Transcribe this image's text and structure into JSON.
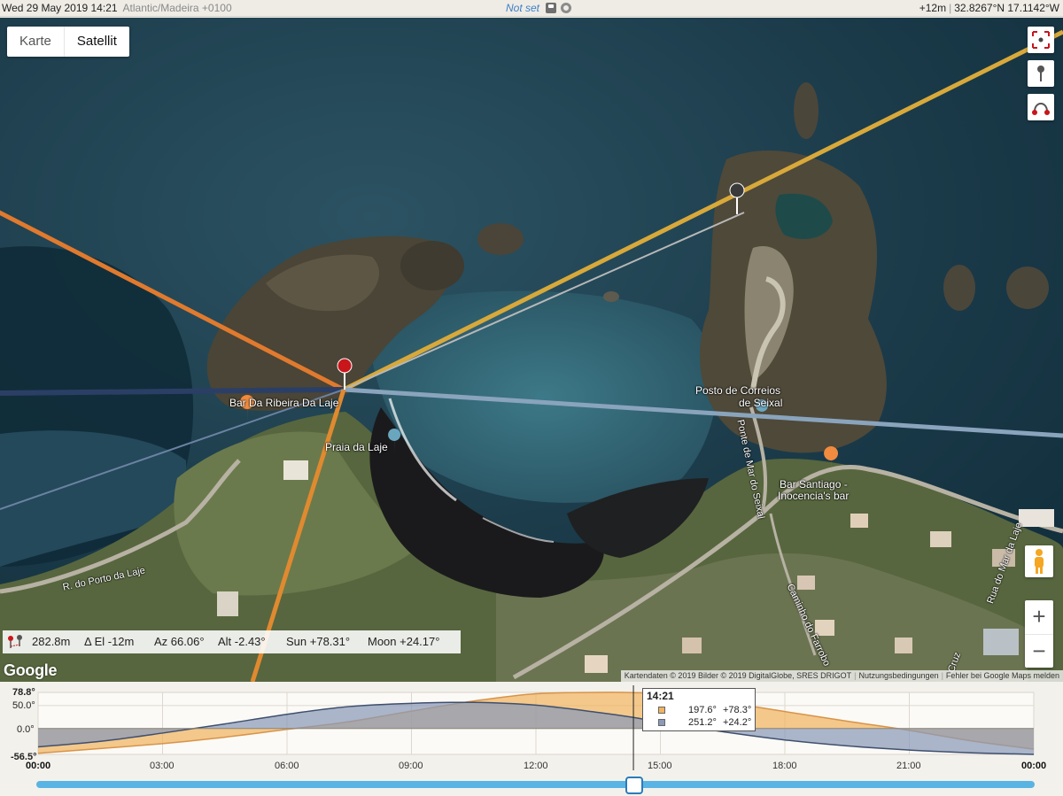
{
  "topbar": {
    "datetime": "Wed 29 May 2019 14:21",
    "timezone": "Atlantic/Madeira +0100",
    "status": "Not set",
    "elevation": "+12m",
    "coords": "32.8267°N 17.1142°W"
  },
  "map": {
    "type_buttons": [
      "Karte",
      "Satellit"
    ],
    "active_type": "Satellit",
    "zoom_in": "+",
    "zoom_out": "−",
    "google_logo": "Google",
    "attribution": {
      "data": "Kartendaten © 2019 Bilder © 2019 DigitalGlobe, SRES DRIGOT",
      "terms": "Nutzungsbedingungen",
      "report": "Fehler bei Google Maps melden"
    },
    "labels": {
      "bar_ribeira": "Bar Da Ribeira Da Laje",
      "praia": "Praia da Laje",
      "posto_1": "Posto de Correios",
      "posto_2": "de Seixal",
      "bar_santiago_1": "Bar Santiago -",
      "bar_santiago_2": "Inocencia's bar",
      "road_porto": "R. do Porto da Laje",
      "road_ponte": "Ponte de Mar do Seixal",
      "road_farrobo": "Caminho do Farrobo",
      "road_mar": "Rua do Mar da Laje",
      "road_cruz": "Cruz"
    },
    "info": {
      "distance": "282.8m",
      "delta_el": "Δ El  -12m",
      "azimuth": "Az 66.06°",
      "altitude": "Alt  -2.43°",
      "sun": "Sun +78.31°",
      "moon": "Moon +24.17°"
    },
    "colors": {
      "sunrise_line": "#e07a2e",
      "sun_line": "#d8a93a",
      "moon_line": "#8aa4bd",
      "moonrise_line": "#2b3f66",
      "sunset_line": "#e08a30"
    }
  },
  "chart_data": {
    "type": "area",
    "x_ticks": [
      "00:00",
      "03:00",
      "06:00",
      "09:00",
      "12:00",
      "15:00",
      "18:00",
      "21:00",
      "00:00"
    ],
    "y_ticks": [
      "78.8°",
      "50.0°",
      "0.0°",
      "-56.5°"
    ],
    "ylim": [
      -56.5,
      78.8
    ],
    "current_time": "14:21",
    "series": [
      {
        "name": "Sun",
        "color": "#f0b460",
        "x": [
          0,
          3,
          4.5,
          6,
          7.5,
          9,
          10.5,
          12,
          13.5,
          14.35,
          15,
          16.5,
          18,
          19.5,
          21,
          22.5,
          24
        ],
        "y": [
          -54,
          -33,
          -19,
          -2,
          15,
          38,
          60,
          76,
          78.8,
          78.3,
          75,
          58,
          37,
          16,
          -4,
          -27,
          -45
        ]
      },
      {
        "name": "Moon",
        "color": "#8a9ab8",
        "x": [
          0,
          1.5,
          3,
          4.5,
          6,
          7.5,
          9,
          10.5,
          12,
          13.5,
          14.35,
          15,
          16.5,
          18,
          19.5,
          21,
          22.5,
          24
        ],
        "y": [
          -40,
          -28,
          -10,
          10,
          31,
          48,
          55,
          57,
          51,
          35,
          24.2,
          14,
          -7,
          -25,
          -38,
          -47,
          -53,
          -56.5
        ]
      }
    ],
    "tooltip": {
      "time": "14:21",
      "rows": [
        {
          "azimuth": "197.6°",
          "altitude": "+78.3°",
          "color": "#f0b460"
        },
        {
          "azimuth": "251.2°",
          "altitude": "+24.2°",
          "color": "#8a9ab8"
        }
      ]
    }
  }
}
